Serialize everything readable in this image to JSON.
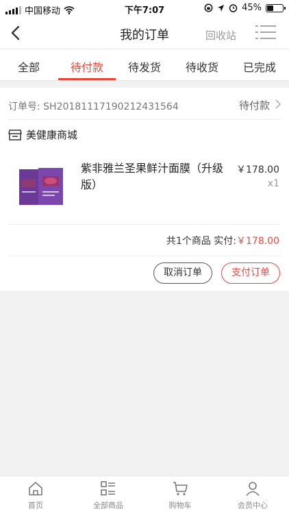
{
  "status_bar": {
    "carrier": "中国移动",
    "time": "下午7:07",
    "battery_text": "45%",
    "battery_level": 0.45
  },
  "nav": {
    "title": "我的订单",
    "recycle_label": "回收站"
  },
  "tabs": [
    {
      "label": "全部",
      "active": false
    },
    {
      "label": "待付款",
      "active": true
    },
    {
      "label": "待发货",
      "active": false
    },
    {
      "label": "待收货",
      "active": false
    },
    {
      "label": "已完成",
      "active": false
    }
  ],
  "order": {
    "order_no": "订单号: SH20181117190212431564",
    "status": "待付款",
    "shop_name": "美健康商城",
    "product": {
      "name": "紫非雅兰圣果鲜汁面膜（升级版）",
      "price": "￥178.00",
      "quantity": "x1"
    },
    "summary_prefix": "共1个商品 实付:",
    "summary_amount": "￥178.00",
    "cancel_label": "取消订单",
    "pay_label": "支付订单"
  },
  "bottom_nav": [
    {
      "label": "首页",
      "icon": "home-icon"
    },
    {
      "label": "全部商品",
      "icon": "category-icon"
    },
    {
      "label": "购物车",
      "icon": "cart-icon"
    },
    {
      "label": "会员中心",
      "icon": "user-icon"
    }
  ],
  "colors": {
    "accent": "#e8473c",
    "background": "#f2f2f2"
  }
}
